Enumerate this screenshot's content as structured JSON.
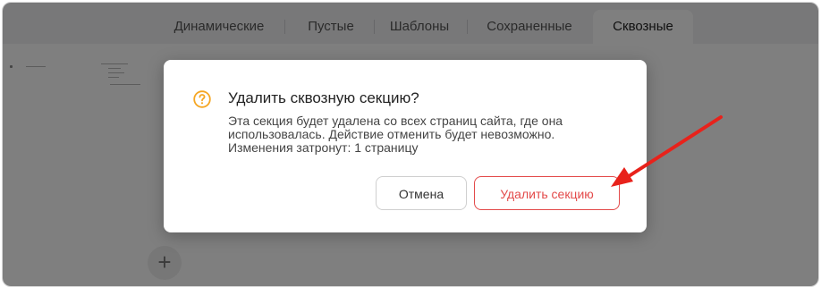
{
  "tabs": [
    {
      "label": "Динамические"
    },
    {
      "label": "Пустые"
    },
    {
      "label": "Шаблоны"
    },
    {
      "label": "Сохраненные"
    },
    {
      "label": "Сквозные",
      "active": true
    }
  ],
  "add_button": {
    "label": "+"
  },
  "dialog": {
    "icon": "question-circle-icon",
    "title": "Удалить сквозную секцию?",
    "body": [
      "Эта секция будет удалена со всех страниц сайта, где она",
      "использовалась. Действие отменить будет невозможно.",
      "Изменения затронут: 1 страницу"
    ],
    "cancel_label": "Отмена",
    "delete_label": "Удалить секцию"
  },
  "colors": {
    "accent_warning": "#F5A623",
    "danger": "#E34A4A",
    "annotation_arrow": "#E8221B"
  }
}
